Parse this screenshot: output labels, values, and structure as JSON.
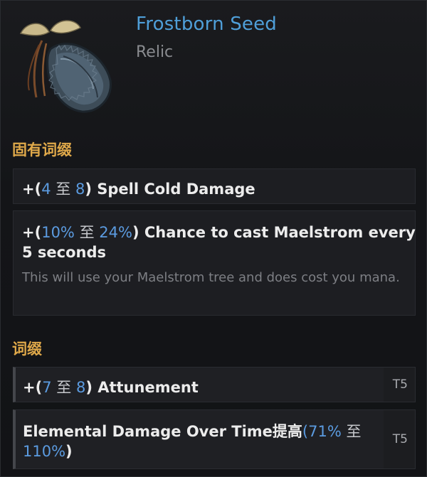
{
  "item": {
    "name": "Frostborn Seed",
    "type": "Relic"
  },
  "implicit": {
    "title": "固有词缀",
    "affixes": [
      {
        "prefix": "+(",
        "min": "4",
        "sep": " 至 ",
        "max": "8",
        "suffix": ") Spell Cold Damage"
      },
      {
        "prefix": "+(",
        "min": "10%",
        "sep": " 至 ",
        "max": "24%",
        "suffix": ") Chance to cast Maelstrom every",
        "line2": "5 seconds",
        "desc": "This will use your Maelstrom tree and does cost you mana."
      }
    ]
  },
  "explicit": {
    "title": "词缀",
    "affixes": [
      {
        "prefix": "+(",
        "min": "7",
        "sep": " 至 ",
        "max": "8",
        "suffix": ") Attunement",
        "tier": "T5"
      },
      {
        "text_a": "Elemental Damage Over Time",
        "text_b": "提高",
        "open": "(",
        "min": "71%",
        "sep": " 至",
        "max": "110%",
        "close": ")",
        "tier": "T5"
      }
    ]
  },
  "colors": {
    "name": "#4f9fd9",
    "section": "#e0a94a",
    "value": "#5b9be0"
  },
  "icon": "frost-seed-relic-icon"
}
